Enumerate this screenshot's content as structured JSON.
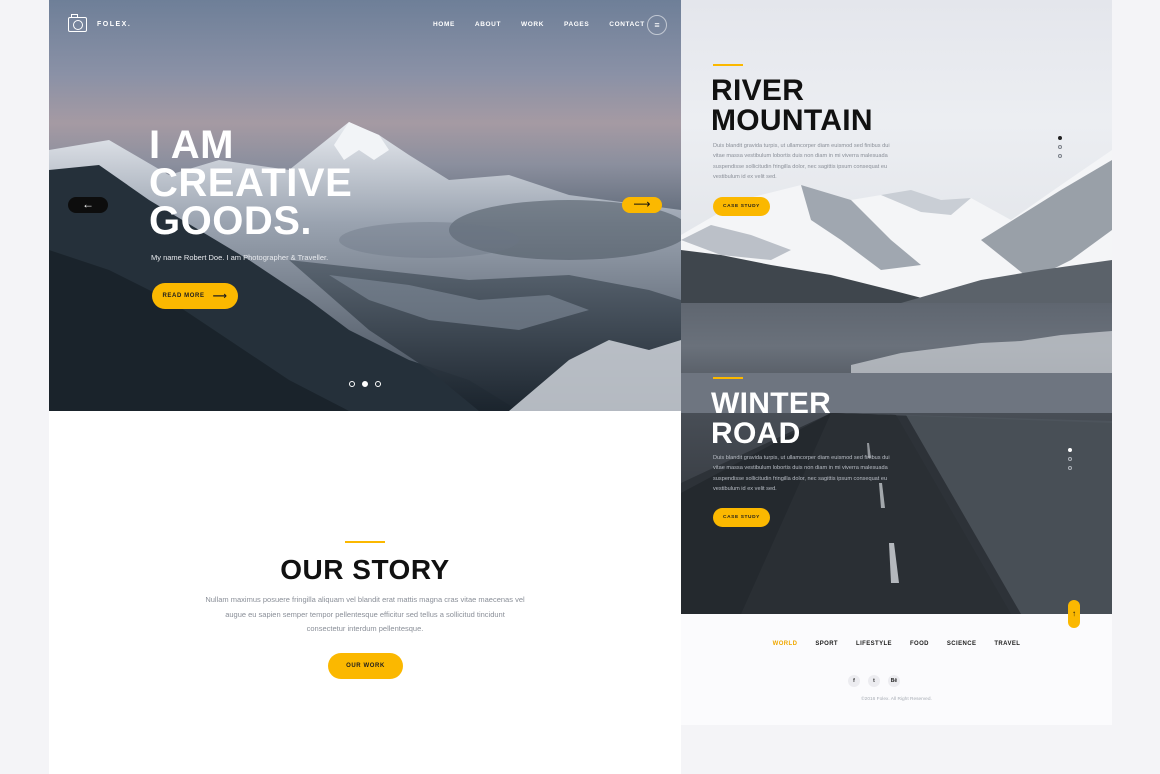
{
  "brand": {
    "name": "FOLEX."
  },
  "nav": {
    "items": [
      "HOME",
      "ABOUT",
      "WORK",
      "PAGES",
      "CONTACT"
    ],
    "menu_icon": "hamburger-icon"
  },
  "hero": {
    "title_lines": [
      "I AM",
      "CREATIVE",
      "GOODS."
    ],
    "subtitle": "My name Robert Doe. I am Photographer & Traveller.",
    "cta_label": "READ MORE",
    "prev_arrow": "←",
    "next_arrow": "⟶",
    "slides_total": 3,
    "slide_active": 2
  },
  "story": {
    "title": "OUR STORY",
    "text": "Nullam maximus posuere fringilla aliquam vel blandit erat mattis magna cras vitae maecenas vel augue eu sapien semper tempor pellentesque efficitur sed tellus a sollicitud tincidunt consectetur interdum pellentesque.",
    "cta_label": "OUR WORK"
  },
  "cards": [
    {
      "title_lines": [
        "RIVER",
        "MOUNTAIN"
      ],
      "text": "Duis blandit gravida turpis, ut ullamcorper diam euismod sed finibus dui vitae massa vestibulum lobortis duis non diam in mi viverra malesuada suspendisse sollicitudin fringilla dolor, nec sagittis ipsum consequat eu vestibulum id ex velit sed.",
      "cta_label": "CASE STUDY"
    },
    {
      "title_lines": [
        "WINTER",
        "ROAD"
      ],
      "text": "Duis blandit gravida turpis, ut ullamcorper diam euismod sed finibus dui vitae massa vestibulum lobortis duis non diam in mi viverra malesuada suspendisse sollicitudin fringilla dolor, nec sagittis ipsum consequat eu vestibulum id ex velit sed.",
      "cta_label": "CASE STUDY"
    }
  ],
  "scroll_top": "↑",
  "footer": {
    "categories": [
      "WORLD",
      "SPORT",
      "LIFESTYLE",
      "FOOD",
      "SCIENCE",
      "TRAVEL"
    ],
    "active_category": "WORLD",
    "social": [
      {
        "icon": "facebook-icon",
        "glyph": "f"
      },
      {
        "icon": "twitter-icon",
        "glyph": "t"
      },
      {
        "icon": "behance-icon",
        "glyph": "Bē"
      }
    ],
    "copyright": "©2016 Folex. All Right Reserved."
  },
  "colors": {
    "accent": "#fbb800",
    "dark": "#111111"
  }
}
